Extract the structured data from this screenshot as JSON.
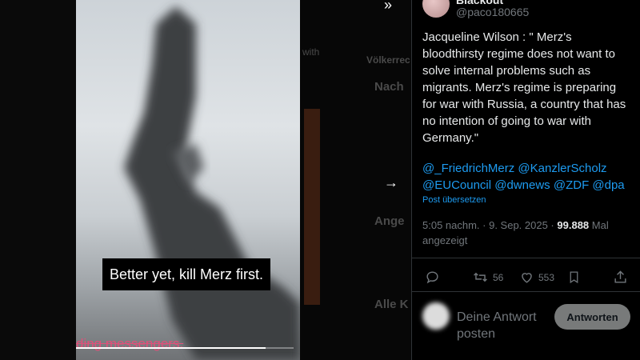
{
  "video": {
    "subtitle": "Better yet, kill Merz first.",
    "ticker": "ding messengers.",
    "progress": 0.87
  },
  "middle": {
    "voelkerrecht": "Völkerrec",
    "nach": "Nach",
    "ange": "Ange",
    "alle": "Alle K",
    "frag": "with"
  },
  "tweet": {
    "author_name": "Blackout",
    "handle": "@paco180665",
    "text": "Jacqueline Wilson : \" Merz's bloodthirsty regime does not want to solve internal problems such as migrants. Merz's regime is preparing for war with Russia, a country that has no intention of going to war with Germany.\"",
    "mentions": "@_FriedrichMerz @KanzlerScholz @EUCouncil @dwnews @ZDF @dpa",
    "translate": "Post übersetzen",
    "timestamp": "5:05 nachm. · 9. Sep. 2025 · ",
    "views": "99.888",
    "views_label": " Mal angezeigt",
    "retweets": "56",
    "likes": "553"
  },
  "reply": {
    "placeholder": "Deine Antwort posten",
    "button": "Antworten"
  },
  "colors": {
    "accent": "#1d9bf0",
    "muted": "#71767b",
    "text": "#e7e9ea"
  },
  "icons": [
    "next-arrow-icon",
    "reply-icon",
    "retweet-icon",
    "like-icon",
    "bookmark-icon",
    "share-icon"
  ]
}
